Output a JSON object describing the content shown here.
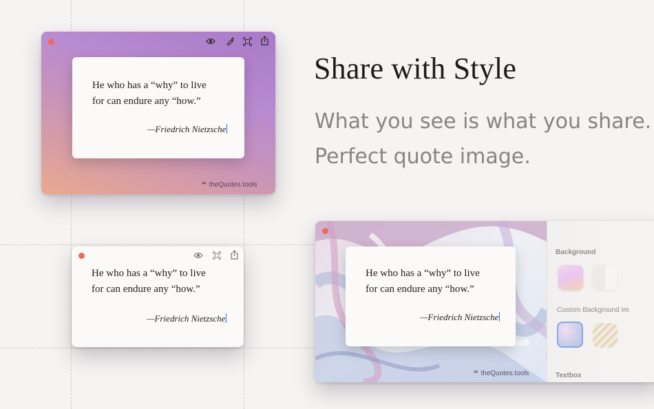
{
  "headline": "Share with Style",
  "subtitle_line1": "What you see is what you share.",
  "subtitle_line2": "Perfect quote image.",
  "quote": {
    "line1": "He who has a “why” to live",
    "line2": "for can endure any “how.”",
    "author": "—Friedrich Nietzsche"
  },
  "brand": {
    "glyph": "“",
    "text": "theQuotes.tools"
  },
  "panel": {
    "background_label": "Background",
    "custom_background_label": "Custom Background Im",
    "textbox_label": "Textbox"
  },
  "icons": {
    "close": "close-dot",
    "preview": "eye-icon",
    "style": "brush-icon",
    "crop": "crop-icon",
    "share": "share-icon"
  },
  "colors": {
    "close": "#ec6b5e",
    "caret": "#3a6fd8",
    "purple_gradient": [
      "#b07fcf",
      "#e5a590"
    ]
  }
}
